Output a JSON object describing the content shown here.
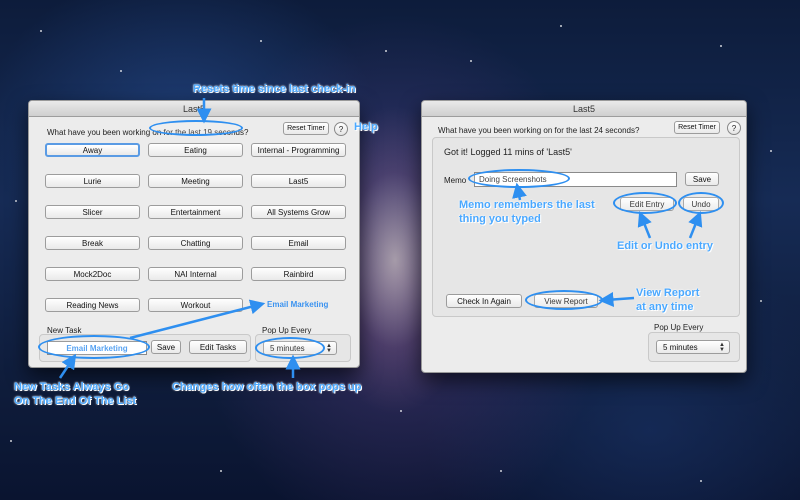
{
  "left_window": {
    "title": "Last5",
    "question": "What have you been working on for the last 19 seconds?",
    "reset_label": "Reset Timer",
    "help_label": "?",
    "tasks": [
      "Away",
      "Eating",
      "Internal - Programming",
      "Lurie",
      "Meeting",
      "Last5",
      "Slicer",
      "Entertainment",
      "All Systems Grow",
      "Break",
      "Chatting",
      "Email",
      "Mock2Doc",
      "NAI Internal",
      "Rainbird",
      "Reading News",
      "Workout"
    ],
    "new_task_item": "Email Marketing",
    "new_task_label": "New Task",
    "new_task_value": "Email Marketing",
    "save_label": "Save",
    "edit_tasks_label": "Edit Tasks",
    "popup_label": "Pop Up Every",
    "popup_value": "5 minutes"
  },
  "right_window": {
    "title": "Last5",
    "question": "What have you been working on for the last 24 seconds?",
    "reset_label": "Reset Timer",
    "help_label": "?",
    "status": "Got it! Logged 11 mins of 'Last5'",
    "memo_label": "Memo",
    "memo_value": "Doing Screenshots",
    "save_label": "Save",
    "edit_entry_label": "Edit Entry",
    "undo_label": "Undo",
    "check_in_label": "Check In Again",
    "view_report_label": "View Report",
    "popup_label": "Pop Up Every",
    "popup_value": "5 minutes"
  },
  "annotations": {
    "reset": "Resets time since last check-in",
    "help": "Help",
    "new_tasks_1": "New Tasks Always Go",
    "new_tasks_2": "On The End Of The List",
    "popup": "Changes how often the box pops up",
    "memo_1": "Memo remembers the last",
    "memo_2": "thing you typed",
    "edit_undo": "Edit or Undo entry",
    "report_1": "View Report",
    "report_2": "at any time"
  },
  "colors": {
    "annotation": "#4aa8ff",
    "highlight": "#2e8ff0",
    "selected_button_border": "#5a9be4"
  }
}
